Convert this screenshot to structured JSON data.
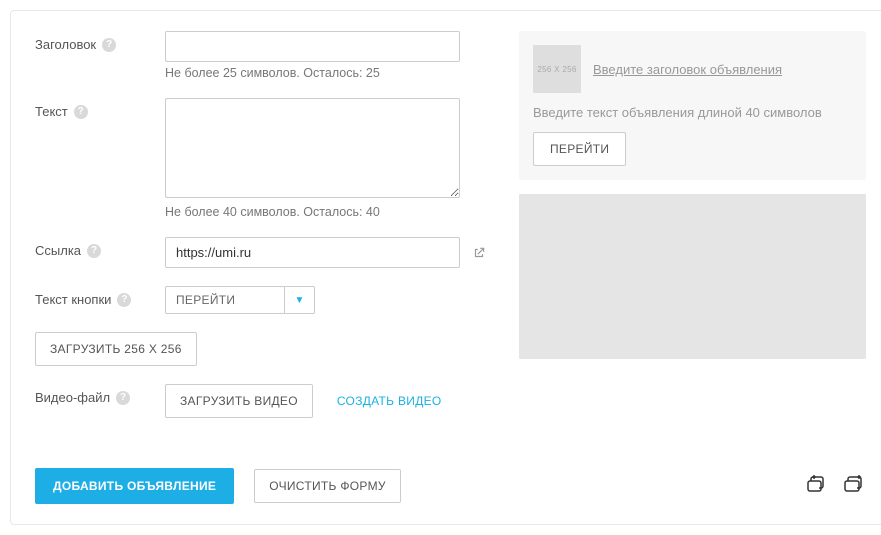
{
  "labels": {
    "title": "Заголовок",
    "text": "Текст",
    "link": "Ссылка",
    "button_text": "Текст кнопки",
    "video_file": "Видео-файл"
  },
  "hints": {
    "title": "Не более 25 символов. Осталось: 25",
    "text": "Не более 40 символов. Осталось: 40"
  },
  "inputs": {
    "title_value": "",
    "text_value": "",
    "link_value": "https://umi.ru",
    "button_select_value": "ПЕРЕЙТИ"
  },
  "buttons": {
    "upload_image": "ЗАГРУЗИТЬ 256 Х 256",
    "upload_video": "ЗАГРУЗИТЬ ВИДЕО",
    "create_video": "СОЗДАТЬ ВИДЕО",
    "add": "ДОБАВИТЬ ОБЪЯВЛЕНИЕ",
    "reset": "ОЧИСТИТЬ ФОРМУ"
  },
  "preview": {
    "thumb_text": "256 X 256",
    "title_placeholder": "Введите заголовок объявления",
    "desc_placeholder": "Введите текст объявления длиной 40 символов",
    "button_label": "ПЕРЕЙТИ"
  }
}
